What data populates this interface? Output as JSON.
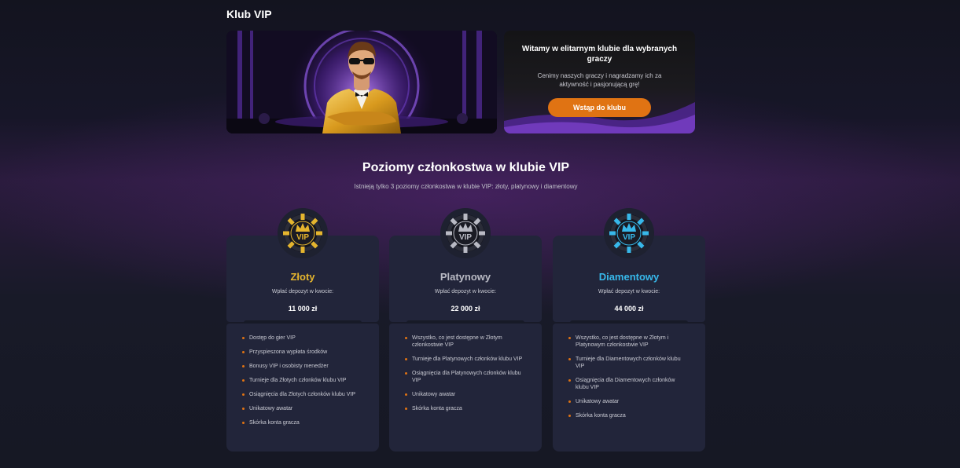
{
  "header": {
    "title": "Klub VIP"
  },
  "welcome": {
    "title": "Witamy w elitarnym klubie dla wybranych graczy",
    "subtitle": "Cenimy naszych graczy i nagradzamy ich za aktywność i pasjonującą grę!",
    "button_label": "Wstąp do klubu"
  },
  "levels": {
    "title": "Poziomy członkostwa w klubie VIP",
    "subtitle": "Istnieją tylko 3 poziomy członkostwa w klubie VIP: złoty, platynowy i diamentowy"
  },
  "tiers": [
    {
      "name": "Złoty",
      "color": "#e5b52e",
      "badge_icon": "vip-chip-gold-icon",
      "badge_text": "VIP",
      "deposit_label": "Wpłać depozyt w kwocie:",
      "amount": "11 000 zł",
      "benefits": [
        "Dostęp do gier VIP",
        "Przyspieszona wypłata środków",
        "Bonusy VIP i osobisty menedżer",
        "Turnieje dla Złotych członków klubu VIP",
        "Osiągnięcia dla Złotych członków klubu VIP",
        "Unikatowy awatar",
        "Skórka konta gracza"
      ]
    },
    {
      "name": "Platynowy",
      "color": "#b9bac4",
      "badge_icon": "vip-chip-platinum-icon",
      "badge_text": "VIP",
      "deposit_label": "Wpłać depozyt w kwocie:",
      "amount": "22 000 zł",
      "benefits": [
        "Wszystko, co jest dostępne w Złotym członkostwie VIP",
        "Turnieje dla Platynowych członków klubu VIP",
        "Osiągnięcia dla Platynowych członków klubu VIP",
        "Unikatowy awatar",
        "Skórka konta gracza"
      ]
    },
    {
      "name": "Diamentowy",
      "color": "#37b8ea",
      "badge_icon": "vip-chip-diamond-icon",
      "badge_text": "VIP",
      "deposit_label": "Wpłać depozyt w kwocie:",
      "amount": "44 000 zł",
      "benefits": [
        "Wszystko, co jest dostępne w Złotym i Platynowym członkostwie VIP",
        "Turnieje dla Diamentowych członków klubu VIP",
        "Osiągnięcia dla Diamentowych członków klubu VIP",
        "Unikatowy awatar",
        "Skórka konta gracza"
      ]
    }
  ],
  "colors": {
    "accent": "#e07313",
    "card_bg": "#22253a",
    "page_bg": "#161824"
  }
}
